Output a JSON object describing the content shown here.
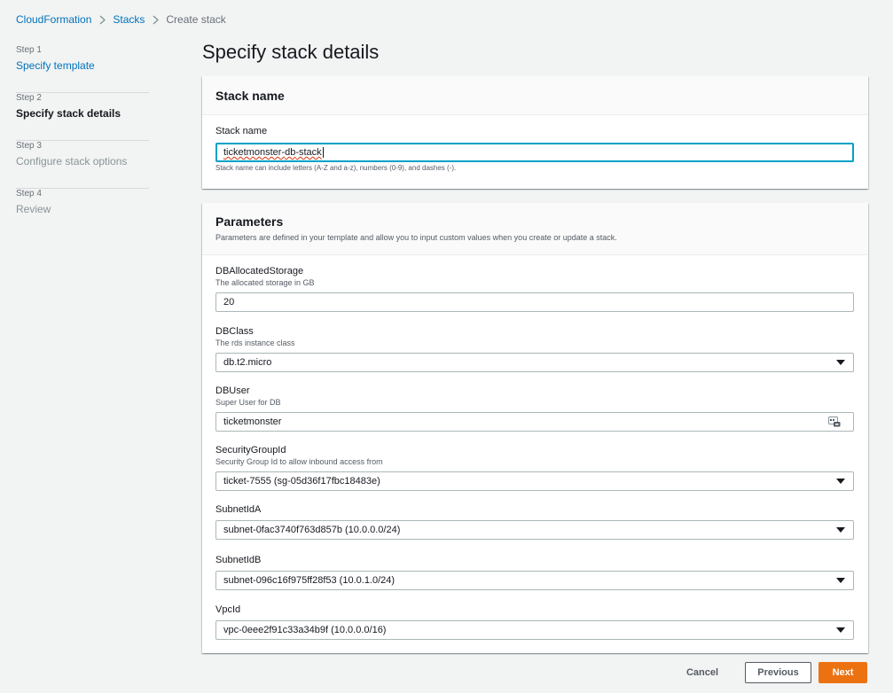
{
  "breadcrumb": {
    "items": [
      "CloudFormation",
      "Stacks"
    ],
    "current": "Create stack"
  },
  "steps": [
    {
      "num": "Step 1",
      "label": "Specify template"
    },
    {
      "num": "Step 2",
      "label": "Specify stack details"
    },
    {
      "num": "Step 3",
      "label": "Configure stack options"
    },
    {
      "num": "Step 4",
      "label": "Review"
    }
  ],
  "page_title": "Specify stack details",
  "stack_panel": {
    "title": "Stack name",
    "field_label": "Stack name",
    "value_part1": "ticketmonster-",
    "value_part2": "db",
    "value_part3": "-stack",
    "hint": "Stack name can include letters (A-Z and a-z), numbers (0-9), and dashes (-)."
  },
  "params_panel": {
    "title": "Parameters",
    "description": "Parameters are defined in your template and allow you to input custom values when you create or update a stack.",
    "fields": [
      {
        "label": "DBAllocatedStorage",
        "desc": "The allocated storage in GB",
        "value": "20"
      },
      {
        "label": "DBClass",
        "desc": "The rds instance class",
        "value": "db.t2.micro"
      },
      {
        "label": "DBUser",
        "desc": "Super User for DB",
        "value": "ticketmonster"
      },
      {
        "label": "SecurityGroupId",
        "desc": "Security Group Id to allow inbound access from",
        "value": "ticket-7555 (sg-05d36f17fbc18483e)"
      },
      {
        "label": "SubnetIdA",
        "desc": "",
        "value": "subnet-0fac3740f763d857b (10.0.0.0/24)"
      },
      {
        "label": "SubnetIdB",
        "desc": "",
        "value": "subnet-096c16f975ff28f53 (10.0.1.0/24)"
      },
      {
        "label": "VpcId",
        "desc": "",
        "value": "vpc-0eee2f91c33a34b9f (10.0.0.0/16)"
      }
    ]
  },
  "actions": {
    "cancel": "Cancel",
    "previous": "Previous",
    "next": "Next"
  },
  "colors": {
    "link": "#0073bb",
    "primary": "#ec7211",
    "focus": "#00a1c9",
    "background": "#f2f3f3"
  }
}
